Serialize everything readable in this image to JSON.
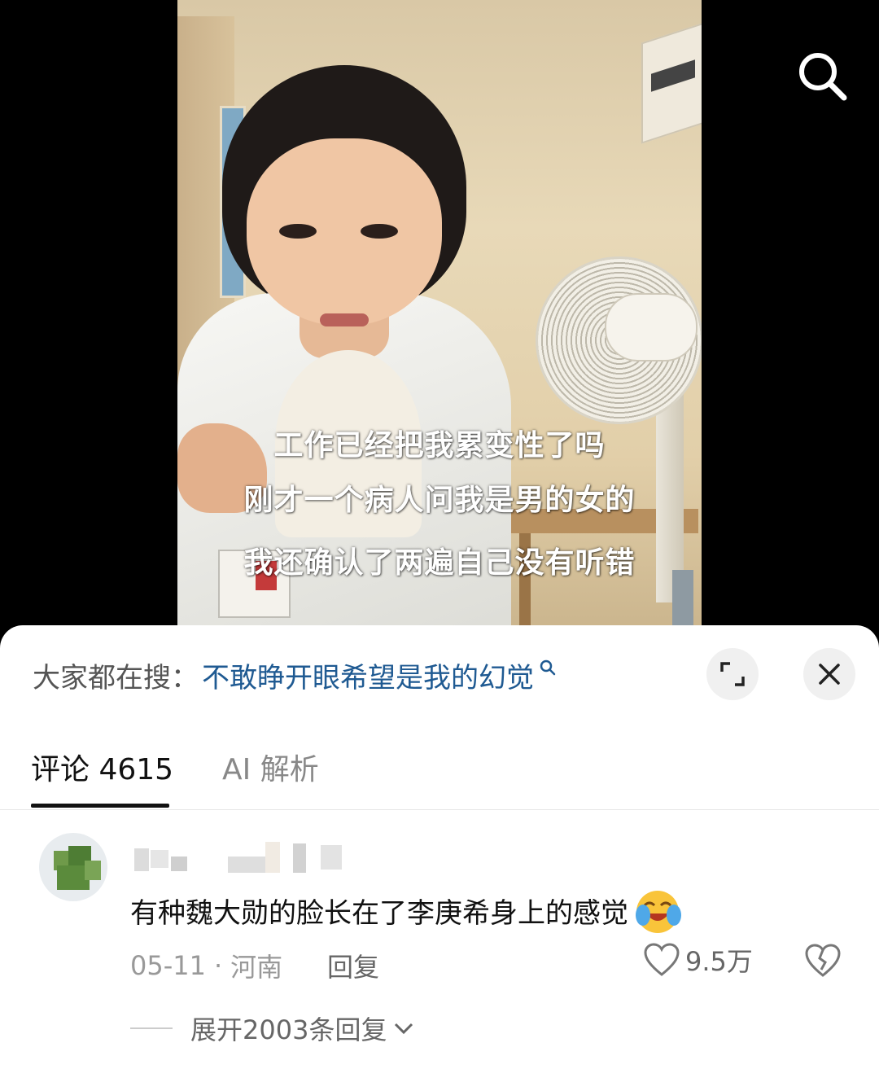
{
  "video": {
    "subtitles": [
      "工作已经把我累变性了吗",
      "刚才一个病人问我是男的女的",
      "我还确认了两遍自己没有听错"
    ]
  },
  "hot_search": {
    "prefix": "大家都在搜：",
    "term": "不敢睁开眼希望是我的幻觉"
  },
  "tabs": {
    "comments": "评论 4615",
    "ai": "AI 解析"
  },
  "comment": {
    "text": "有种魏大勋的脸长在了李庚希身上的感觉",
    "date": "05-11",
    "location": "河南",
    "separator": "·",
    "reply_label": "回复",
    "like_count": "9.5万",
    "expand_replies": "展开2003条回复"
  }
}
